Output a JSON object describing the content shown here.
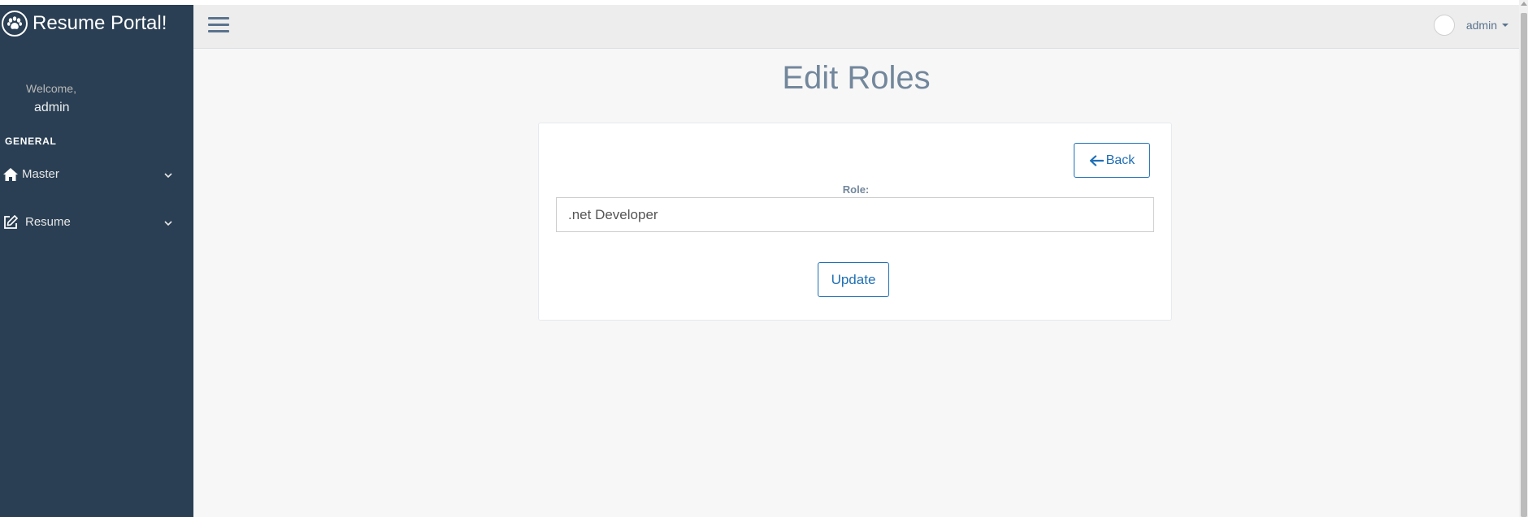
{
  "app": {
    "title": "Resume Portal!"
  },
  "sidebar": {
    "welcome_text": "Welcome,",
    "username": "admin",
    "section_title": "GENERAL",
    "items": [
      {
        "label": "Master",
        "icon": "home-icon"
      },
      {
        "label": "Resume",
        "icon": "edit-icon"
      }
    ]
  },
  "header": {
    "user_label": "admin"
  },
  "main": {
    "page_title": "Edit Roles",
    "back_label": "Back",
    "role_label": "Role:",
    "role_value": ".net Developer",
    "update_label": "Update"
  },
  "colors": {
    "sidebar_bg": "#2a3f54",
    "accent": "#1f6fb5",
    "title": "#73879c"
  }
}
